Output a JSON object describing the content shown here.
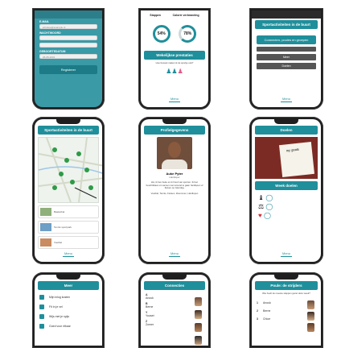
{
  "registration": {
    "label_email": "E-MAIL",
    "email_placeholder": "johndoe@example.nl",
    "label_password": "WACHTWOORD",
    "label_birthdate": "GEBOORTEDATUM",
    "birthdate_value": "26-05-2001",
    "register_button": "Registreer"
  },
  "goals_progress": {
    "tab_steps": "Stappen",
    "tab_calories": "Calorie verbranding",
    "steps_percent": "54%",
    "calories_percent": "78%",
    "section_title": "Wekelijkse prestaties",
    "question": "Hoe bewust maken ik de sportje ook?",
    "menu_label": "Menu"
  },
  "sport_menu": {
    "title": "Sportactiviteiten in de buurt",
    "btn_connect": "Connecten, poules en groepen",
    "btn_1": "Meer",
    "btn_2": "Doelen",
    "menu_label": "Menu"
  },
  "map": {
    "title": "Sportactiviteiten in de buurt",
    "card1_title": "Basketbal",
    "card2_title": "Tennis sportpark",
    "card3_title": "Voetbal",
    "menu_label": "Menu"
  },
  "profile": {
    "title": "Profielgegevens",
    "name": "Auke Pyter",
    "subtitle": "Hardloper",
    "bio": "Hoi, ik ben Auke en ik houd van sporten. Ik ben beschikbaar om samen met iemand te gaan hardlopen of fietsen op zaterdag.",
    "interests": "Voetbal, Tennis, Fietsen, Zwemmen, Hardlopen",
    "menu_label": "Menu"
  },
  "goals": {
    "title": "Doelen",
    "notebook_text": "my goals",
    "section_title": "Week doelen",
    "menu_label": "Menu"
  },
  "more_menu": {
    "title": "Meer",
    "items": [
      "Mijn inlog kosten",
      "Fit in je vel",
      "Wijs met je spijs",
      "Goed voor elkaar"
    ]
  },
  "connections": {
    "title": "Connecties",
    "letters": [
      "A",
      "B",
      "Y",
      "Z"
    ],
    "contacts": [
      "Anouk",
      "Berne",
      "Youset",
      "Zomer"
    ]
  },
  "leaderboard": {
    "title": "Poule: de strijders",
    "subtitle": "Wie heeft de meeste stappen gezet deze week?",
    "rows": [
      {
        "rank": "1",
        "name": "Anouk"
      },
      {
        "rank": "2",
        "name": "Berne"
      },
      {
        "rank": "3",
        "name": "Chloe"
      }
    ]
  }
}
